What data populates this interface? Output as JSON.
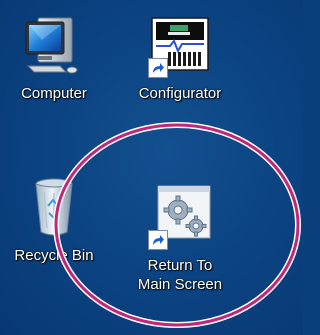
{
  "desktop": {
    "icons": [
      {
        "label": "Computer",
        "icon": "computer-icon"
      },
      {
        "label": "Configurator",
        "icon": "configurator-icon",
        "shortcut": true
      },
      {
        "label": "Recycle Bin",
        "icon": "recycle-bin-icon"
      },
      {
        "label_line1": "Return To",
        "label_line2": "Main Screen",
        "icon": "gear-window-icon",
        "shortcut": true
      }
    ],
    "annotation": {
      "shape": "ellipse",
      "color": "#c0277a"
    }
  }
}
